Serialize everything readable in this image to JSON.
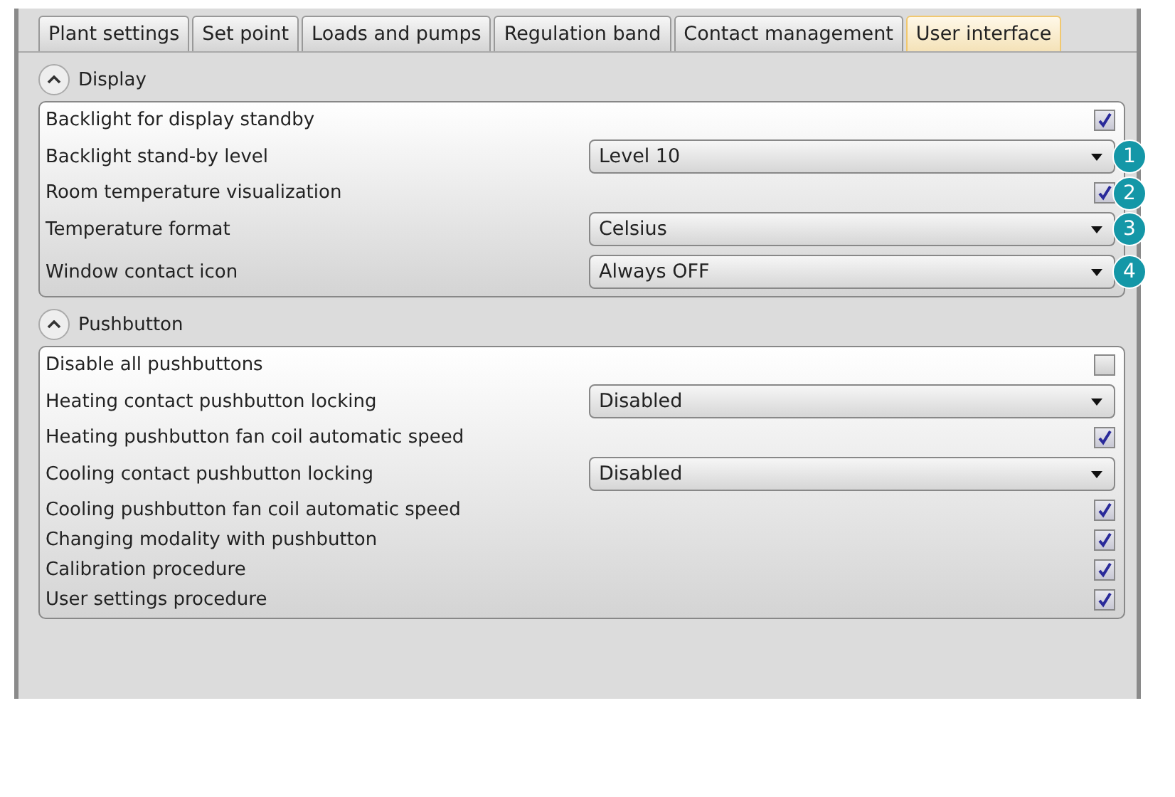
{
  "tabs": [
    {
      "label": "Plant settings",
      "selected": false
    },
    {
      "label": "Set point",
      "selected": false
    },
    {
      "label": "Loads and pumps",
      "selected": false
    },
    {
      "label": "Regulation band",
      "selected": false
    },
    {
      "label": "Contact management",
      "selected": false
    },
    {
      "label": "User interface",
      "selected": true
    }
  ],
  "sections": [
    {
      "title": "Display",
      "expanded": true,
      "rows": [
        {
          "kind": "checkbox",
          "label": "Backlight for display standby",
          "checked": true
        },
        {
          "kind": "dropdown",
          "label": "Backlight stand-by level",
          "value": "Level 10",
          "callout": "1"
        },
        {
          "kind": "checkbox",
          "label": "Room temperature visualization",
          "checked": true,
          "callout": "2"
        },
        {
          "kind": "dropdown",
          "label": "Temperature format",
          "value": "Celsius",
          "callout": "3"
        },
        {
          "kind": "dropdown",
          "label": "Window contact icon",
          "value": "Always OFF",
          "callout": "4"
        }
      ]
    },
    {
      "title": "Pushbutton",
      "expanded": true,
      "rows": [
        {
          "kind": "checkbox",
          "label": "Disable all pushbuttons",
          "checked": false
        },
        {
          "kind": "dropdown",
          "label": "Heating contact pushbutton locking",
          "value": "Disabled"
        },
        {
          "kind": "checkbox",
          "label": "Heating pushbutton fan coil automatic speed",
          "checked": true
        },
        {
          "kind": "dropdown",
          "label": "Cooling contact pushbutton locking",
          "value": "Disabled"
        },
        {
          "kind": "checkbox",
          "label": "Cooling pushbutton fan coil automatic speed",
          "checked": true
        },
        {
          "kind": "checkbox",
          "label": "Changing modality with pushbutton",
          "checked": true
        },
        {
          "kind": "checkbox",
          "label": "Calibration procedure",
          "checked": true
        },
        {
          "kind": "checkbox",
          "label": "User settings procedure",
          "checked": true
        }
      ]
    }
  ]
}
